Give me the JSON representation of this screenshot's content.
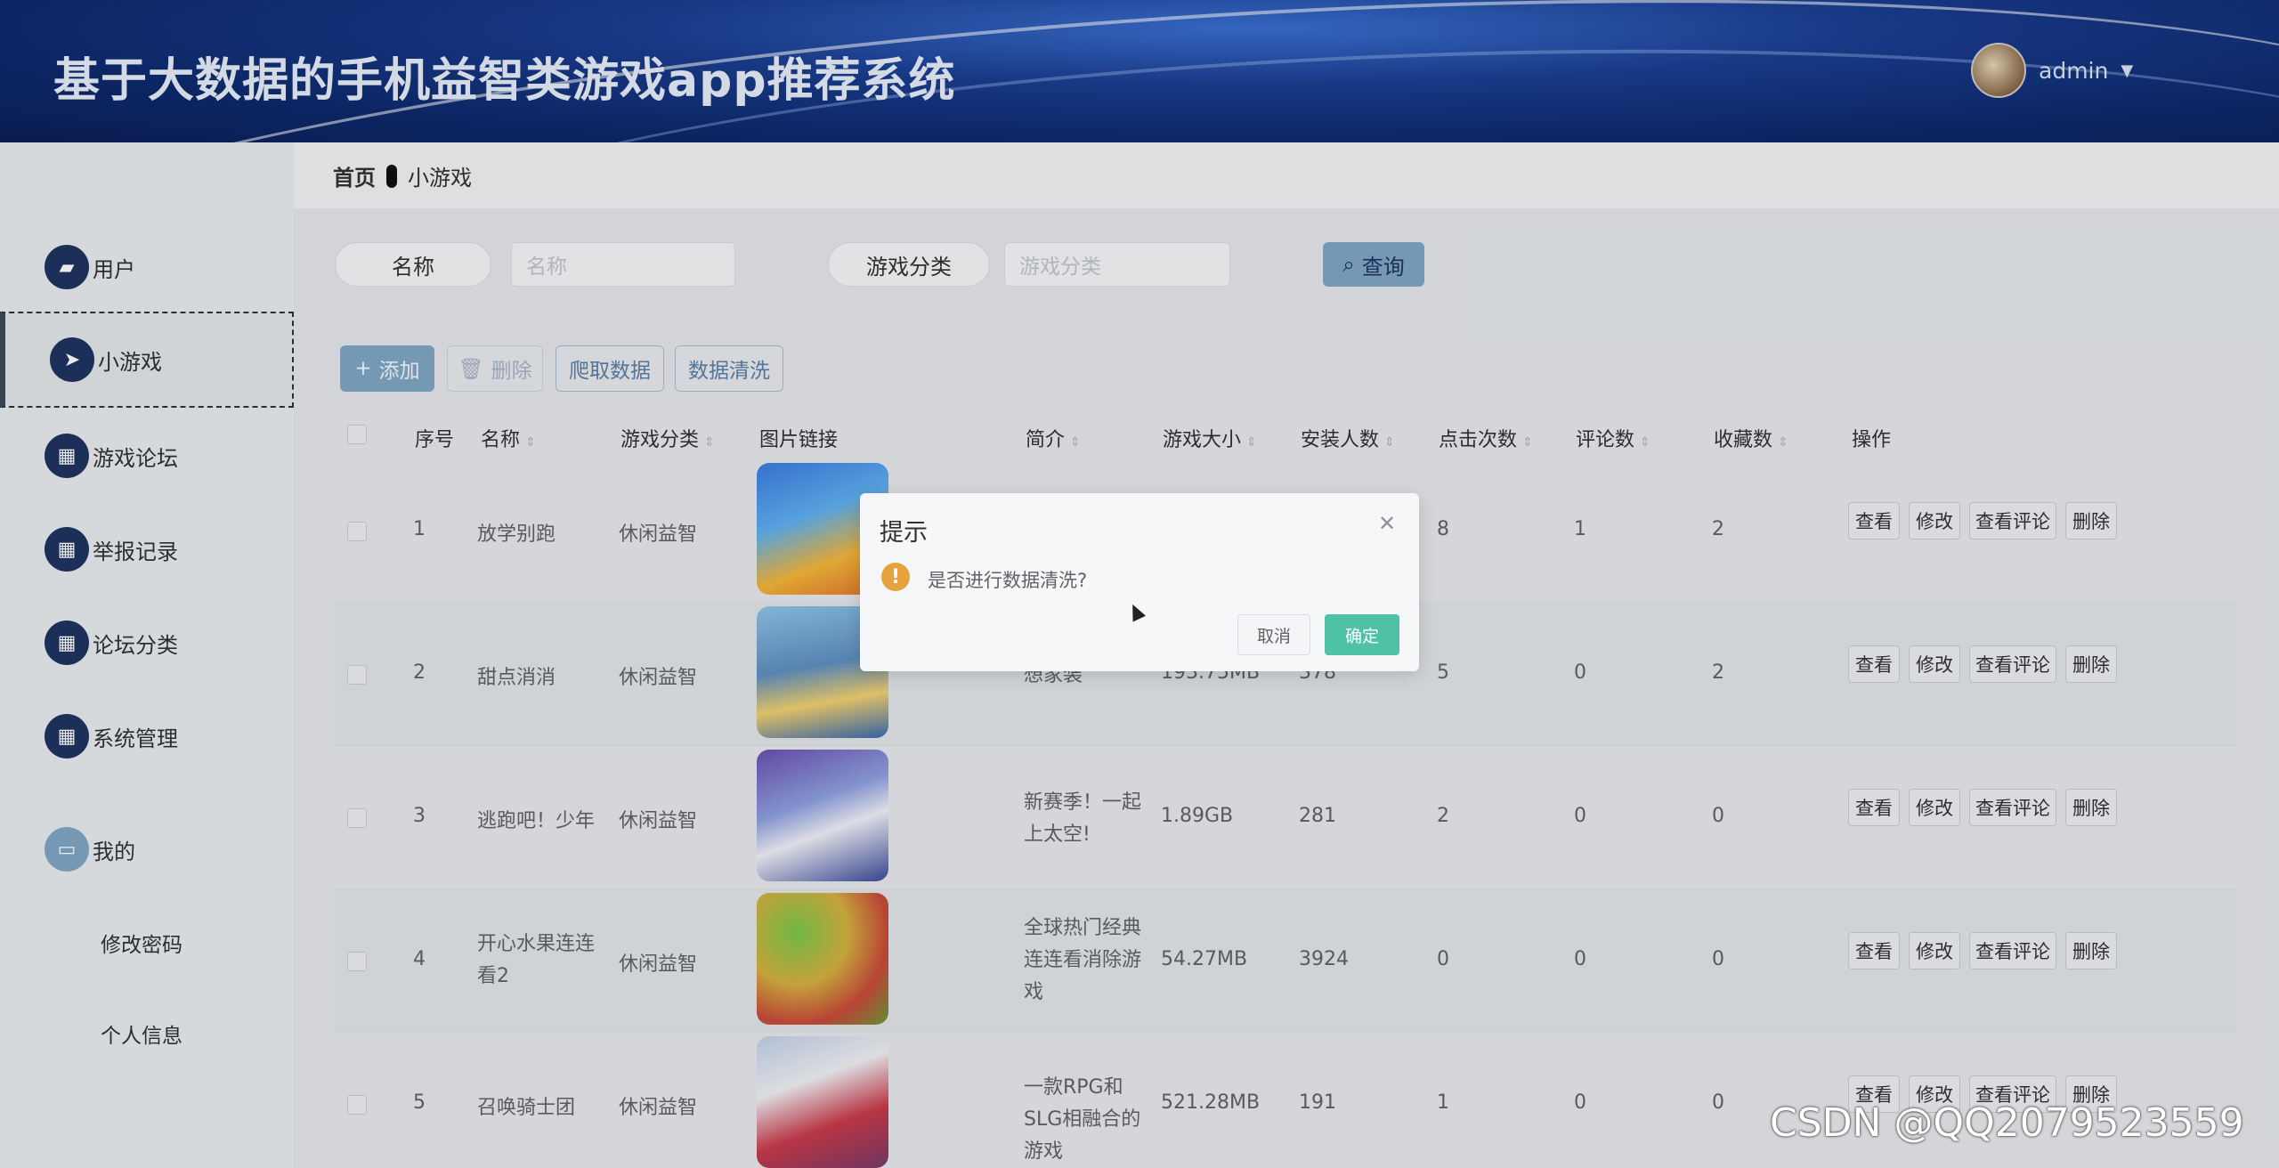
{
  "header": {
    "title": "基于大数据的手机益智类游戏app推荐系统",
    "user_name": "admin"
  },
  "sidebar": {
    "items": [
      {
        "label": "用户",
        "icon": "briefcase-icon"
      },
      {
        "label": "小游戏",
        "icon": "send-icon"
      },
      {
        "label": "游戏论坛",
        "icon": "grid-icon"
      },
      {
        "label": "举报记录",
        "icon": "grid-icon"
      },
      {
        "label": "论坛分类",
        "icon": "grid-icon"
      },
      {
        "label": "系统管理",
        "icon": "grid-icon"
      },
      {
        "label": "我的",
        "icon": "wallet-icon"
      }
    ],
    "sub_items": [
      "修改密码",
      "个人信息"
    ]
  },
  "breadcrumb": {
    "home": "首页",
    "current": "小游戏"
  },
  "search": {
    "name_label": "名称",
    "name_placeholder": "名称",
    "category_label": "游戏分类",
    "category_placeholder": "游戏分类",
    "query_label": "查询"
  },
  "toolbar": {
    "add_label": "添加",
    "delete_label": "删除",
    "crawl_label": "爬取数据",
    "clean_label": "数据清洗"
  },
  "table": {
    "headers": [
      "序号",
      "名称",
      "游戏分类",
      "图片链接",
      "简介",
      "游戏大小",
      "安装人数",
      "点击次数",
      "评论数",
      "收藏数",
      "操作"
    ],
    "actions": [
      "查看",
      "修改",
      "查看评论",
      "删除"
    ],
    "rows": [
      {
        "no": "1",
        "name": "放学别跑",
        "category": "休闲益智",
        "intro": "",
        "size": "",
        "installs": "",
        "clicks": "8",
        "comments": "1",
        "favorites": "2"
      },
      {
        "no": "2",
        "name": "甜点消消",
        "category": "休闲益智",
        "intro": "小家，设计梦想家装",
        "size": "193.75MB",
        "installs": "378",
        "clicks": "5",
        "comments": "0",
        "favorites": "2"
      },
      {
        "no": "3",
        "name": "逃跑吧！少年",
        "category": "休闲益智",
        "intro": "新赛季！一起上太空!",
        "size": "1.89GB",
        "installs": "281",
        "clicks": "2",
        "comments": "0",
        "favorites": "0"
      },
      {
        "no": "4",
        "name": "开心水果连连看2",
        "category": "休闲益智",
        "intro": "全球热门经典连连看消除游戏",
        "size": "54.27MB",
        "installs": "3924",
        "clicks": "0",
        "comments": "0",
        "favorites": "0"
      },
      {
        "no": "5",
        "name": "召唤骑士团",
        "category": "休闲益智",
        "intro": "一款RPG和SLG相融合的游戏",
        "size": "521.28MB",
        "installs": "191",
        "clicks": "1",
        "comments": "0",
        "favorites": "0"
      }
    ]
  },
  "dialog": {
    "title": "提示",
    "message": "是否进行数据清洗?",
    "cancel_label": "取消",
    "confirm_label": "确定"
  },
  "watermark": "CSDN @QQ2079523559"
}
